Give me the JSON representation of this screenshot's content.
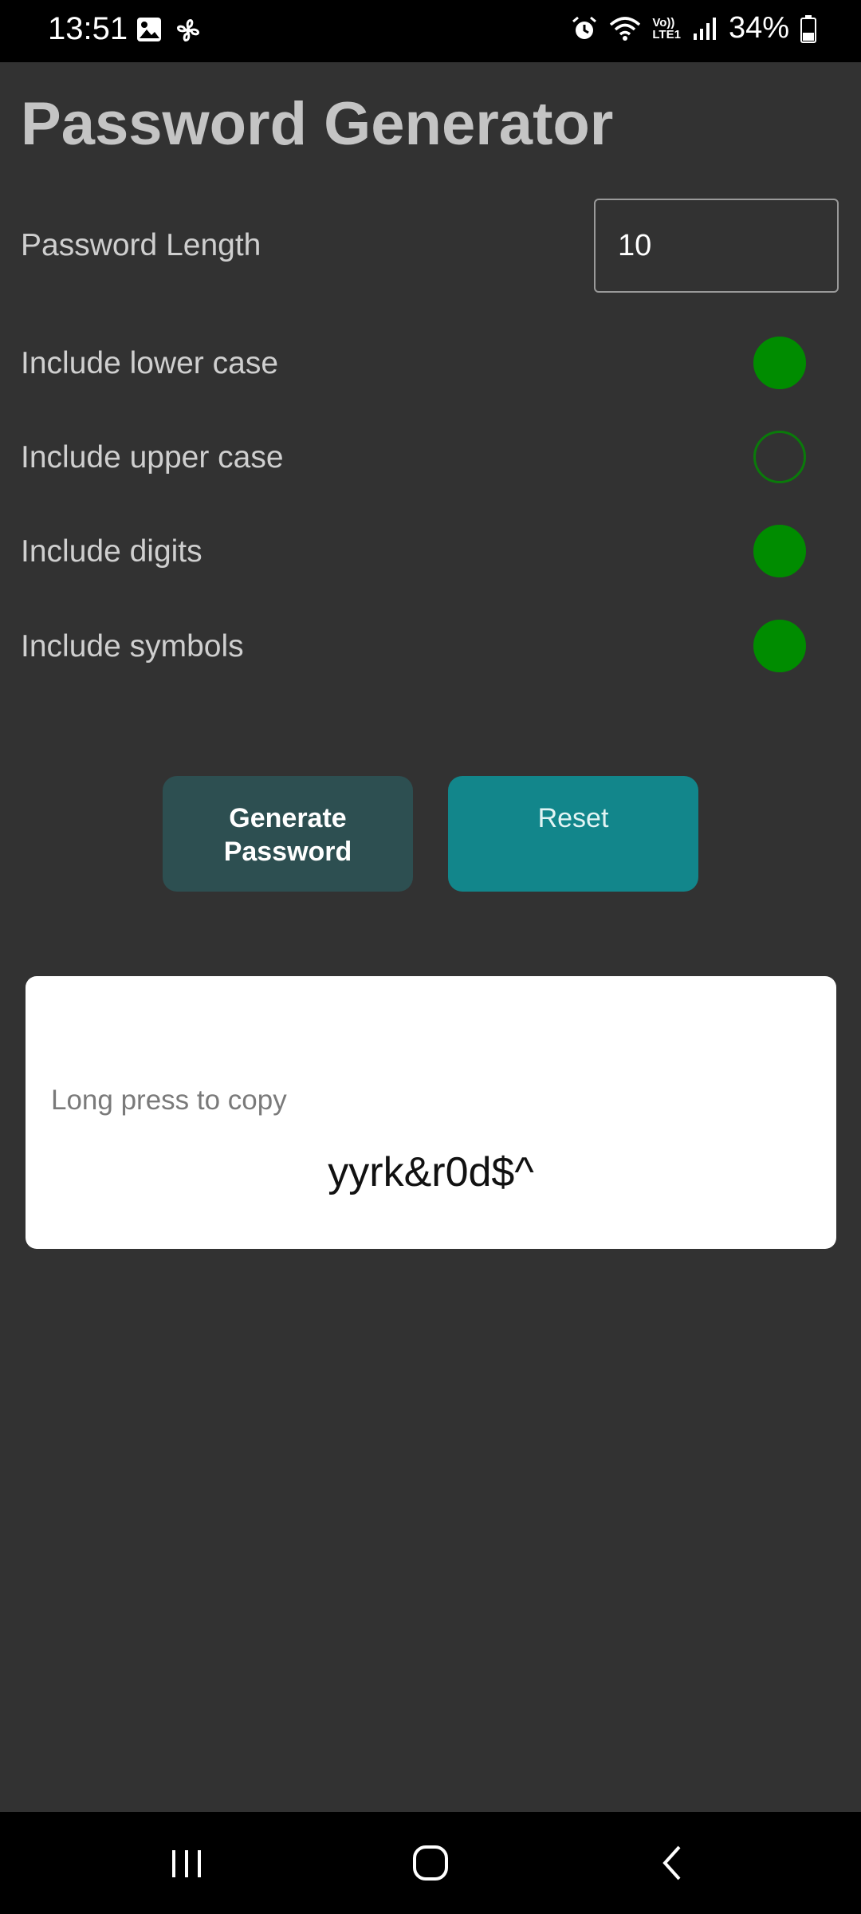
{
  "status_bar": {
    "time": "13:51",
    "battery": "34%",
    "icons": [
      "gallery-icon",
      "pinwheel-icon",
      "alarm-icon",
      "wifi-icon",
      "volte-icon",
      "signal-icon",
      "battery-icon"
    ],
    "volte_label_top": "Vo))",
    "volte_label_bottom": "LTE1"
  },
  "app": {
    "title": "Password Generator",
    "length_label": "Password Length",
    "length_value": "10",
    "options": [
      {
        "label": "Include lower case",
        "checked": true
      },
      {
        "label": "Include upper case",
        "checked": false
      },
      {
        "label": "Include digits",
        "checked": true
      },
      {
        "label": "Include symbols",
        "checked": true
      }
    ],
    "generate_label": "Generate Password",
    "reset_label": "Reset",
    "copy_hint": "Long press to copy",
    "password": "yyrk&r0d$^"
  },
  "colors": {
    "background": "#323232",
    "radio_on": "#008c00",
    "generate_button": "#2d4f51",
    "reset_button": "#12868b"
  },
  "nav_bar": {
    "icons": [
      "recent-apps-icon",
      "home-icon",
      "back-icon"
    ]
  }
}
